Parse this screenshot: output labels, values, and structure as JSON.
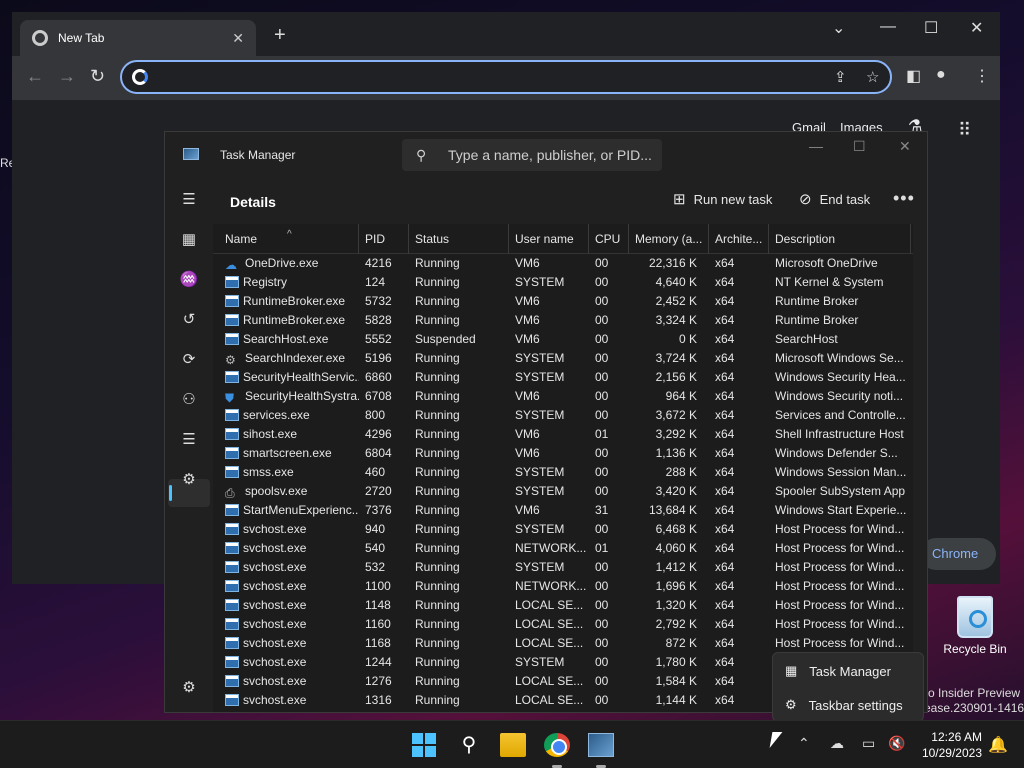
{
  "desktop": {
    "left_edge_text": "Re",
    "recycle_bin_label": "Recycle Bin",
    "watermark_line1": "ro Insider Preview",
    "watermark_line2": "ease.230901-1416"
  },
  "browser": {
    "tab_title": "New Tab",
    "omnibox_value": "",
    "ntp_links": [
      "Gmail",
      "Images"
    ],
    "chrome_pill_text": "Chrome"
  },
  "task_manager": {
    "window_title": "Task Manager",
    "search_placeholder": "Type a name, publisher, or PID...",
    "page_title": "Details",
    "run_new_task": "Run new task",
    "end_task": "End task",
    "columns": [
      "Name",
      "PID",
      "Status",
      "User name",
      "CPU",
      "Memory (a...",
      "Archite...",
      "Description"
    ],
    "rows": [
      {
        "icon": "cloud",
        "name": "OneDrive.exe",
        "pid": "4216",
        "status": "Running",
        "user": "VM6",
        "cpu": "00",
        "mem": "22,316 K",
        "arch": "x64",
        "desc": "Microsoft OneDrive"
      },
      {
        "icon": "window",
        "name": "Registry",
        "pid": "124",
        "status": "Running",
        "user": "SYSTEM",
        "cpu": "00",
        "mem": "4,640 K",
        "arch": "x64",
        "desc": "NT Kernel & System"
      },
      {
        "icon": "window",
        "name": "RuntimeBroker.exe",
        "pid": "5732",
        "status": "Running",
        "user": "VM6",
        "cpu": "00",
        "mem": "2,452 K",
        "arch": "x64",
        "desc": "Runtime Broker"
      },
      {
        "icon": "window",
        "name": "RuntimeBroker.exe",
        "pid": "5828",
        "status": "Running",
        "user": "VM6",
        "cpu": "00",
        "mem": "3,324 K",
        "arch": "x64",
        "desc": "Runtime Broker"
      },
      {
        "icon": "window",
        "name": "SearchHost.exe",
        "pid": "5552",
        "status": "Suspended",
        "user": "VM6",
        "cpu": "00",
        "mem": "0 K",
        "arch": "x64",
        "desc": "SearchHost"
      },
      {
        "icon": "gear",
        "name": "SearchIndexer.exe",
        "pid": "5196",
        "status": "Running",
        "user": "SYSTEM",
        "cpu": "00",
        "mem": "3,724 K",
        "arch": "x64",
        "desc": "Microsoft Windows Se..."
      },
      {
        "icon": "window",
        "name": "SecurityHealthServic...",
        "pid": "6860",
        "status": "Running",
        "user": "SYSTEM",
        "cpu": "00",
        "mem": "2,156 K",
        "arch": "x64",
        "desc": "Windows Security Hea..."
      },
      {
        "icon": "shield",
        "name": "SecurityHealthSystra...",
        "pid": "6708",
        "status": "Running",
        "user": "VM6",
        "cpu": "00",
        "mem": "964 K",
        "arch": "x64",
        "desc": "Windows Security noti..."
      },
      {
        "icon": "window",
        "name": "services.exe",
        "pid": "800",
        "status": "Running",
        "user": "SYSTEM",
        "cpu": "00",
        "mem": "3,672 K",
        "arch": "x64",
        "desc": "Services and Controlle..."
      },
      {
        "icon": "window",
        "name": "sihost.exe",
        "pid": "4296",
        "status": "Running",
        "user": "VM6",
        "cpu": "01",
        "mem": "3,292 K",
        "arch": "x64",
        "desc": "Shell Infrastructure Host"
      },
      {
        "icon": "window",
        "name": "smartscreen.exe",
        "pid": "6804",
        "status": "Running",
        "user": "VM6",
        "cpu": "00",
        "mem": "1,136 K",
        "arch": "x64",
        "desc": "Windows Defender S..."
      },
      {
        "icon": "window",
        "name": "smss.exe",
        "pid": "460",
        "status": "Running",
        "user": "SYSTEM",
        "cpu": "00",
        "mem": "288 K",
        "arch": "x64",
        "desc": "Windows Session Man..."
      },
      {
        "icon": "printer",
        "name": "spoolsv.exe",
        "pid": "2720",
        "status": "Running",
        "user": "SYSTEM",
        "cpu": "00",
        "mem": "3,420 K",
        "arch": "x64",
        "desc": "Spooler SubSystem App"
      },
      {
        "icon": "window",
        "name": "StartMenuExperienc...",
        "pid": "7376",
        "status": "Running",
        "user": "VM6",
        "cpu": "31",
        "mem": "13,684 K",
        "arch": "x64",
        "desc": "Windows Start Experie..."
      },
      {
        "icon": "window",
        "name": "svchost.exe",
        "pid": "940",
        "status": "Running",
        "user": "SYSTEM",
        "cpu": "00",
        "mem": "6,468 K",
        "arch": "x64",
        "desc": "Host Process for Wind..."
      },
      {
        "icon": "window",
        "name": "svchost.exe",
        "pid": "540",
        "status": "Running",
        "user": "NETWORK...",
        "cpu": "01",
        "mem": "4,060 K",
        "arch": "x64",
        "desc": "Host Process for Wind..."
      },
      {
        "icon": "window",
        "name": "svchost.exe",
        "pid": "532",
        "status": "Running",
        "user": "SYSTEM",
        "cpu": "00",
        "mem": "1,412 K",
        "arch": "x64",
        "desc": "Host Process for Wind..."
      },
      {
        "icon": "window",
        "name": "svchost.exe",
        "pid": "1100",
        "status": "Running",
        "user": "NETWORK...",
        "cpu": "00",
        "mem": "1,696 K",
        "arch": "x64",
        "desc": "Host Process for Wind..."
      },
      {
        "icon": "window",
        "name": "svchost.exe",
        "pid": "1148",
        "status": "Running",
        "user": "LOCAL SE...",
        "cpu": "00",
        "mem": "1,320 K",
        "arch": "x64",
        "desc": "Host Process for Wind..."
      },
      {
        "icon": "window",
        "name": "svchost.exe",
        "pid": "1160",
        "status": "Running",
        "user": "LOCAL SE...",
        "cpu": "00",
        "mem": "2,792 K",
        "arch": "x64",
        "desc": "Host Process for Wind..."
      },
      {
        "icon": "window",
        "name": "svchost.exe",
        "pid": "1168",
        "status": "Running",
        "user": "LOCAL SE...",
        "cpu": "00",
        "mem": "872 K",
        "arch": "x64",
        "desc": "Host Process for Wind..."
      },
      {
        "icon": "window",
        "name": "svchost.exe",
        "pid": "1244",
        "status": "Running",
        "user": "SYSTEM",
        "cpu": "00",
        "mem": "1,780 K",
        "arch": "x64",
        "desc": ""
      },
      {
        "icon": "window",
        "name": "svchost.exe",
        "pid": "1276",
        "status": "Running",
        "user": "LOCAL SE...",
        "cpu": "00",
        "mem": "1,584 K",
        "arch": "x64",
        "desc": ""
      },
      {
        "icon": "window",
        "name": "svchost.exe",
        "pid": "1316",
        "status": "Running",
        "user": "LOCAL SE...",
        "cpu": "00",
        "mem": "1,144 K",
        "arch": "x64",
        "desc": ""
      }
    ]
  },
  "context_menu": {
    "items": [
      "Task Manager",
      "Taskbar settings"
    ]
  },
  "taskbar": {
    "time": "12:26 AM",
    "date": "10/29/2023"
  }
}
